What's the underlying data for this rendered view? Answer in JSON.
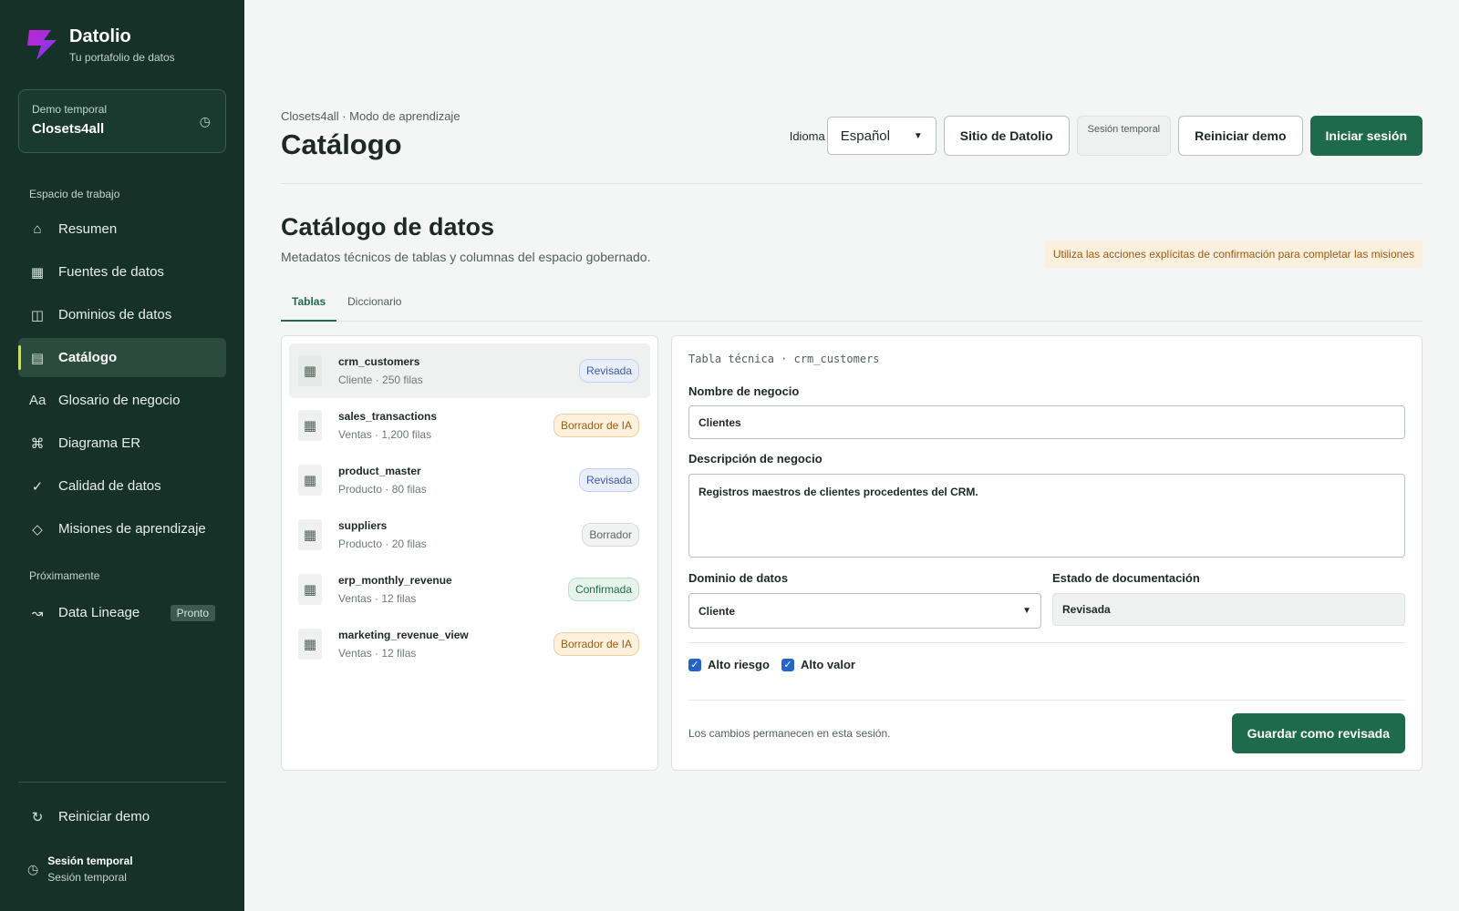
{
  "brand": {
    "name": "Datolio",
    "subtitle": "Tu portafolio de datos",
    "accent": "#8b3cf7"
  },
  "demo_card": {
    "label": "Demo temporal",
    "value": "Closets4all",
    "icon": "clock-icon"
  },
  "sidebar": {
    "workspace_label": "Espacio de trabajo",
    "items": [
      {
        "label": "Resumen",
        "icon": "home-icon",
        "glyph": "⌂"
      },
      {
        "label": "Fuentes de datos",
        "icon": "grid-icon",
        "glyph": "▦"
      },
      {
        "label": "Dominios de datos",
        "icon": "columns-icon",
        "glyph": "◫"
      },
      {
        "label": "Catálogo",
        "icon": "list-icon",
        "glyph": "▤"
      },
      {
        "label": "Glosario de negocio",
        "icon": "text-icon",
        "glyph": "Aa"
      },
      {
        "label": "Diagrama ER",
        "icon": "command-icon",
        "glyph": "⌘"
      },
      {
        "label": "Calidad de datos",
        "icon": "check-icon",
        "glyph": "✓"
      },
      {
        "label": "Misiones de aprendizaje",
        "icon": "diamond-icon",
        "glyph": "◇"
      }
    ],
    "soon_label": "Próximamente",
    "soon_items": [
      {
        "label": "Data Lineage",
        "icon": "trend-icon",
        "glyph": "↝",
        "badge": "Pronto"
      }
    ],
    "reset": {
      "label": "Reiniciar demo",
      "icon": "refresh-icon",
      "glyph": "↻"
    },
    "session": {
      "title": "Sesión temporal",
      "subtitle": "Sesión temporal",
      "icon": "clock-icon"
    }
  },
  "header": {
    "breadcrumb": "Closets4all · Modo de aprendizaje",
    "title": "Catálogo",
    "language_label": "Idioma",
    "language_value": "Español",
    "site_button": "Sitio de Datolio",
    "session_chip": "Sesión temporal",
    "reset_button": "Reiniciar demo",
    "login_button": "Iniciar sesión"
  },
  "section": {
    "title": "Catálogo de datos",
    "description": "Metadatos técnicos de tablas y columnas del espacio gobernado.",
    "notice": "Utiliza las acciones explícitas de confirmación para completar las misiones"
  },
  "tabs": [
    {
      "label": "Tablas"
    },
    {
      "label": "Diccionario"
    }
  ],
  "tables": [
    {
      "name": "crm_customers",
      "meta": "Cliente · 250 filas",
      "status": "Revisada",
      "kind": "reviewed"
    },
    {
      "name": "sales_transactions",
      "meta": "Ventas · 1,200 filas",
      "status": "Borrador de IA",
      "kind": "ai"
    },
    {
      "name": "product_master",
      "meta": "Producto · 80 filas",
      "status": "Revisada",
      "kind": "reviewed"
    },
    {
      "name": "suppliers",
      "meta": "Producto · 20 filas",
      "status": "Borrador",
      "kind": "draft"
    },
    {
      "name": "erp_monthly_revenue",
      "meta": "Ventas · 12 filas",
      "status": "Confirmada",
      "kind": "confirmed"
    },
    {
      "name": "marketing_revenue_view",
      "meta": "Ventas · 12 filas",
      "status": "Borrador de IA",
      "kind": "ai"
    }
  ],
  "detail": {
    "technical_title": "Tabla técnica · crm_customers",
    "business_name_label": "Nombre de negocio",
    "business_name_value": "Clientes",
    "business_desc_label": "Descripción de negocio",
    "business_desc_value": "Registros maestros de clientes procedentes del CRM.",
    "domain_label": "Dominio de datos",
    "domain_value": "Cliente",
    "doc_status_label": "Estado de documentación",
    "doc_status_value": "Revisada",
    "high_risk_label": "Alto riesgo",
    "high_value_label": "Alto valor",
    "footer_note": "Los cambios permanecen en esta sesión.",
    "save_button": "Guardar como revisada"
  }
}
